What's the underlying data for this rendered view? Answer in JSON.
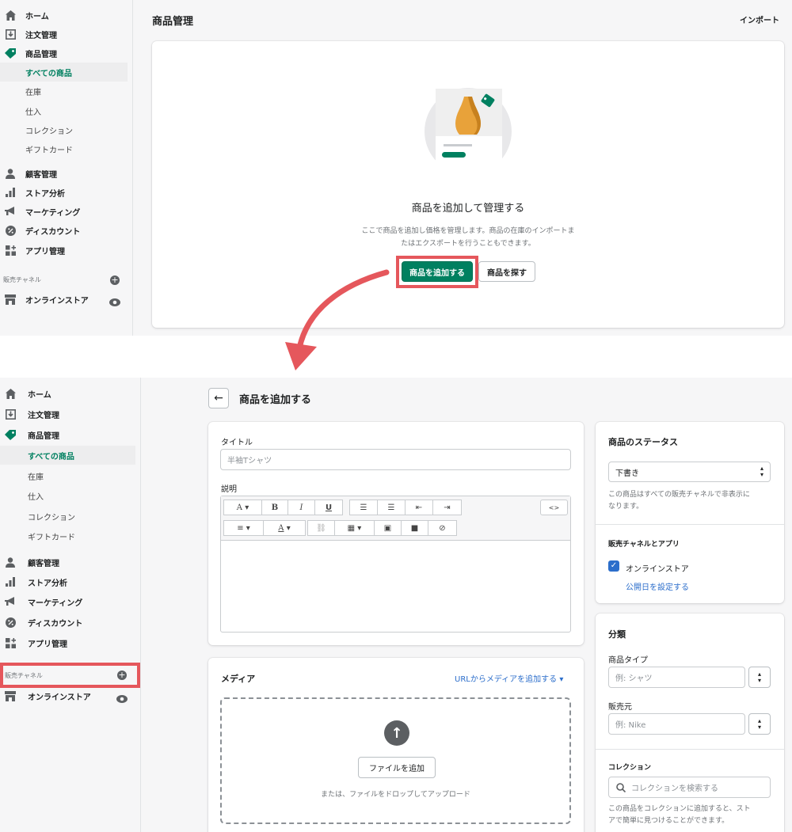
{
  "colors": {
    "accent": "#008060",
    "highlight": "#e5575c",
    "link": "#2c6ecb"
  },
  "top": {
    "page_title": "商品管理",
    "import_label": "インポート",
    "nav": [
      {
        "label": "ホーム",
        "icon": "home-icon"
      },
      {
        "label": "注文管理",
        "icon": "orders-icon"
      },
      {
        "label": "商品管理",
        "icon": "tag-icon"
      },
      {
        "label": "顧客管理",
        "icon": "customer-icon"
      },
      {
        "label": "ストア分析",
        "icon": "analytics-icon"
      },
      {
        "label": "マーケティング",
        "icon": "megaphone-icon"
      },
      {
        "label": "ディスカウント",
        "icon": "discount-icon"
      },
      {
        "label": "アプリ管理",
        "icon": "apps-icon"
      }
    ],
    "subnav": [
      "すべての商品",
      "在庫",
      "仕入",
      "コレクション",
      "ギフトカード"
    ],
    "channels_label": "販売チャネル",
    "online_store": "オンラインストア",
    "empty": {
      "heading": "商品を追加して管理する",
      "desc1": "ここで商品を追加し価格を管理します。商品の在庫のインポートま",
      "desc2": "たはエクスポートを行うこともできます。",
      "primary": "商品を追加する",
      "secondary": "商品を探す"
    }
  },
  "bottom": {
    "page_title": "商品を追加する",
    "title_label": "タイトル",
    "title_placeholder": "半袖Tシャツ",
    "desc_label": "説明",
    "toolbar": {
      "font": "A",
      "bold": "B",
      "italic": "I",
      "underline": "U",
      "html": "<>",
      "color": "A"
    },
    "media": {
      "title": "メディア",
      "url_link": "URLからメディアを追加する",
      "add_file": "ファイルを追加",
      "drop_text": "または、ファイルをドロップしてアップロード"
    },
    "status": {
      "title": "商品のステータス",
      "value": "下書き",
      "note1": "この商品はすべての販売チャネルで非表示に",
      "note2": "なります。",
      "channels_title": "販売チャネルとアプリ",
      "online_store": "オンラインストア",
      "schedule": "公開日を設定する"
    },
    "classification": {
      "title": "分類",
      "type_label": "商品タイプ",
      "type_placeholder": "例: シャツ",
      "vendor_label": "販売元",
      "vendor_placeholder": "例: Nike",
      "collection_label": "コレクション",
      "collection_placeholder": "コレクションを検索する",
      "collection_note1": "この商品をコレクションに追加すると、スト",
      "collection_note2": "アで簡単に見つけることができます。"
    }
  }
}
